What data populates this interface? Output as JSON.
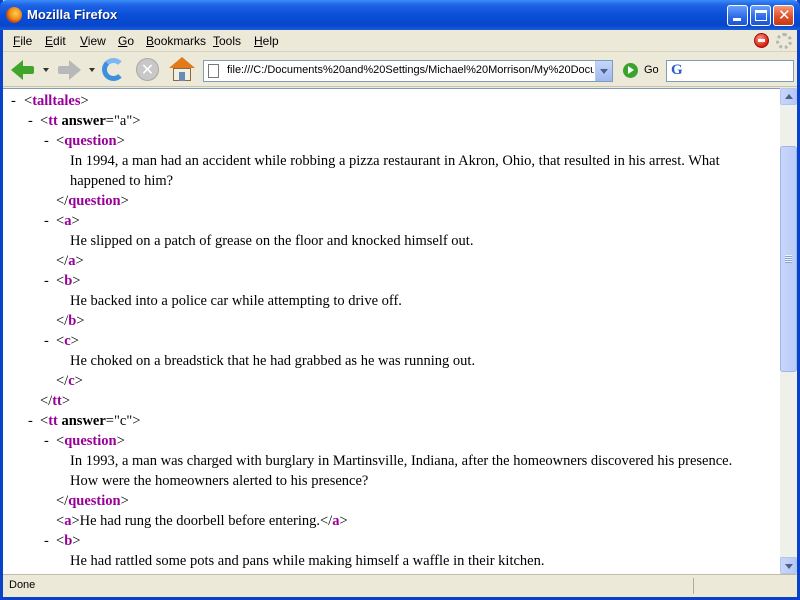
{
  "window": {
    "title": "Mozilla Firefox"
  },
  "menu": {
    "items": [
      "File",
      "Edit",
      "View",
      "Go",
      "Bookmarks",
      "Tools",
      "Help"
    ]
  },
  "toolbar": {
    "url": "file:///C:/Documents%20and%20Settings/Michael%20Morrison/My%20Docu",
    "go_label": "Go",
    "search_value": ""
  },
  "xml": {
    "marker": "-",
    "lines": [
      {
        "indent": 0,
        "marker": true,
        "open": "talltales"
      },
      {
        "indent": 1,
        "marker": true,
        "open": "tt",
        "attr": "answer",
        "val": "a"
      },
      {
        "indent": 2,
        "marker": true,
        "open": "question"
      },
      {
        "indent": 3,
        "text": "In 1994, a man had an accident while robbing a pizza restaurant in Akron, Ohio, that resulted in his arrest. What"
      },
      {
        "indent": 3,
        "text": "happened to him?"
      },
      {
        "indent": 2,
        "close": "question"
      },
      {
        "indent": 2,
        "marker": true,
        "open": "a"
      },
      {
        "indent": 3,
        "text": "He slipped on a patch of grease on the floor and knocked himself out."
      },
      {
        "indent": 2,
        "close": "a"
      },
      {
        "indent": 2,
        "marker": true,
        "open": "b"
      },
      {
        "indent": 3,
        "text": "He backed into a police car while attempting to drive off."
      },
      {
        "indent": 2,
        "close": "b"
      },
      {
        "indent": 2,
        "marker": true,
        "open": "c"
      },
      {
        "indent": 3,
        "text": "He choked on a breadstick that he had grabbed as he was running out."
      },
      {
        "indent": 2,
        "close": "c"
      },
      {
        "indent": 1,
        "close": "tt"
      },
      {
        "indent": 1,
        "marker": true,
        "open": "tt",
        "attr": "answer",
        "val": "c"
      },
      {
        "indent": 2,
        "marker": true,
        "open": "question"
      },
      {
        "indent": 3,
        "text": "In 1993, a man was charged with burglary in Martinsville, Indiana, after the homeowners discovered his presence."
      },
      {
        "indent": 3,
        "text": "How were the homeowners alerted to his presence?"
      },
      {
        "indent": 2,
        "close": "question"
      },
      {
        "indent": 2,
        "inline": "a",
        "text": "He had rung the doorbell before entering."
      },
      {
        "indent": 2,
        "marker": true,
        "open": "b"
      },
      {
        "indent": 3,
        "text": "He had rattled some pots and pans while making himself a waffle in their kitchen."
      }
    ]
  },
  "status": {
    "text": "Done"
  }
}
